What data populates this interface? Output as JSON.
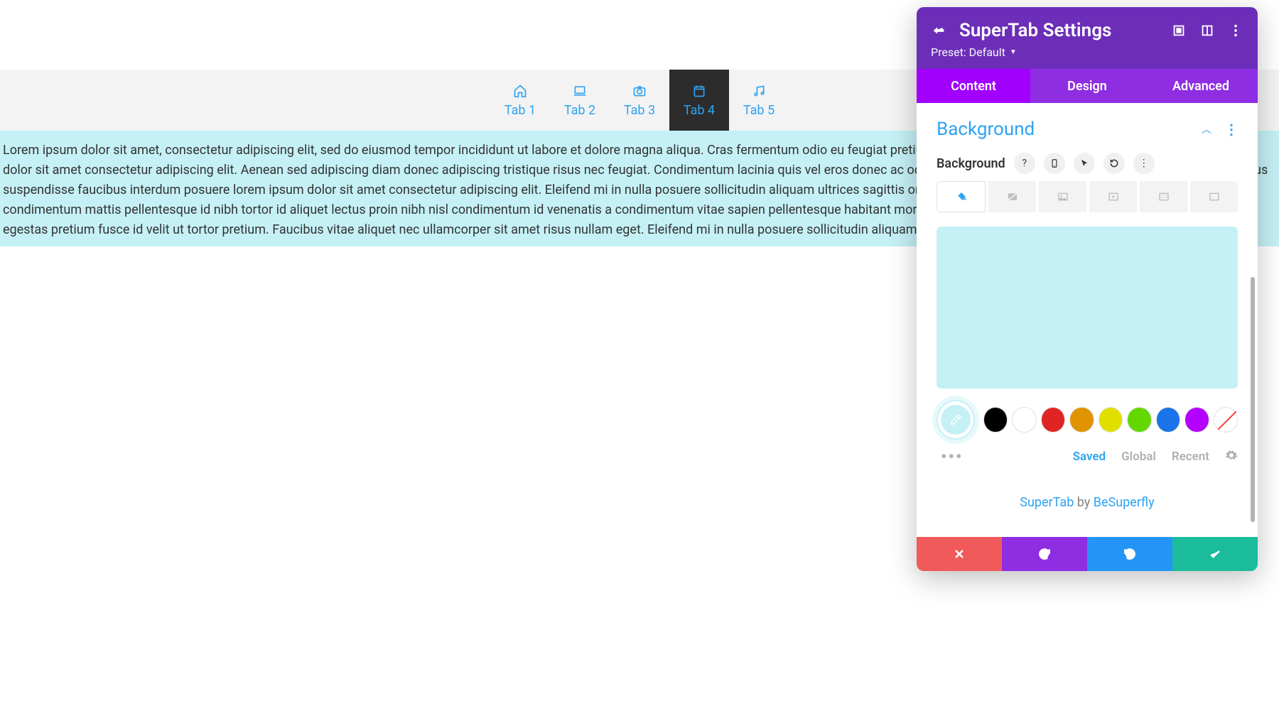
{
  "preview": {
    "tabs": [
      {
        "label": "Tab 1"
      },
      {
        "label": "Tab 2"
      },
      {
        "label": "Tab 3"
      },
      {
        "label": "Tab 4",
        "active": true
      },
      {
        "label": "Tab 5"
      }
    ],
    "content_text": "Lorem ipsum dolor sit amet, consectetur adipiscing elit, sed do eiusmod tempor incididunt ut labore et dolore magna aliqua. Cras fermentum odio eu feugiat pretium nibh. Vel facilisis mauris sit amet. Posuere lorem ipsum dolor sit amet consectetur adipiscing elit. Aenean sed adipiscing diam donec adipiscing tristique risus nec feugiat. Condimentum lacinia quis vel eros donec ac odio. Diam vel quam elementum pulvinar etiam non quam lacus suspendisse faucibus interdum posuere lorem ipsum dolor sit amet consectetur adipiscing elit. Eleifend mi in nulla posuere sollicitudin aliquam ultrices sagittis orci a scelerisque purus semper eget duis at tellus at urna condimentum mattis pellentesque id nibh tortor id aliquet lectus proin nibh nisl condimentum id venenatis a condimentum vitae sapien pellentesque habitant morbi tristique senectus et netus et malesuada fames ac turpis egestas pretium fusce id velit ut tortor pretium. Faucibus vitae aliquet nec ullamcorper sit amet risus nullam eget. Eleifend mi in nulla posuere sollicitudin aliquam."
  },
  "panel": {
    "title": "SuperTab Settings",
    "preset_label": "Preset: Default",
    "tabs": {
      "content": "Content",
      "design": "Design",
      "advanced": "Advanced",
      "active": "content"
    },
    "section": {
      "title": "Background",
      "setting_label": "Background"
    },
    "background_color": "#c5f1f6",
    "swatches": [
      "#000000",
      "#ffffff",
      "#e02424",
      "#e09400",
      "#e0e000",
      "#62d800",
      "#1a73e8",
      "#b400ff"
    ],
    "swatch_tabs": {
      "saved": "Saved",
      "global": "Global",
      "recent": "Recent",
      "active": "saved"
    },
    "credit": {
      "product": "SuperTab",
      "by": " by ",
      "author": "BeSuperfly"
    }
  }
}
